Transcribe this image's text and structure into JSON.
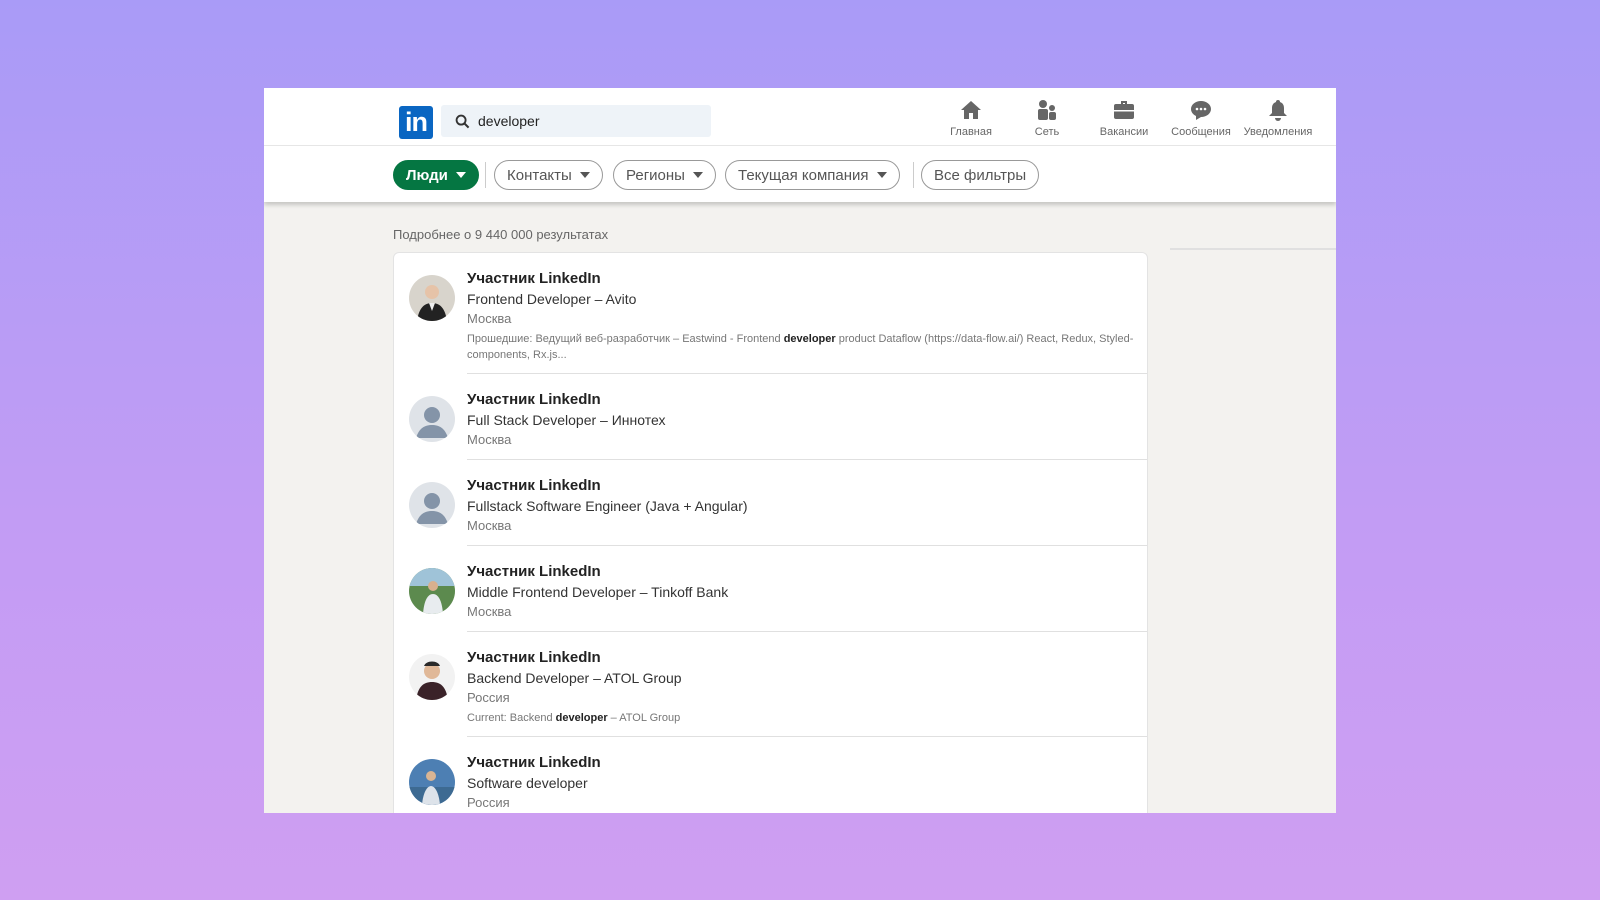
{
  "header": {
    "search_value": "developer",
    "nav": [
      {
        "icon": "home-icon",
        "label": "Главная"
      },
      {
        "icon": "network-icon",
        "label": "Сеть"
      },
      {
        "icon": "briefcase-icon",
        "label": "Вакансии"
      },
      {
        "icon": "messages-icon",
        "label": "Сообщения"
      },
      {
        "icon": "bell-icon",
        "label": "Уведомления"
      }
    ]
  },
  "filters": {
    "people": "Люди",
    "contacts": "Контакты",
    "regions": "Регионы",
    "company": "Текущая компания",
    "all": "Все фильтры"
  },
  "results": {
    "count": "Подробнее о 9 440 000 результатах",
    "items": [
      {
        "name": "Участник LinkedIn",
        "title": "Frontend Developer – Avito",
        "location": "Москва",
        "snippet_pre": "Прошедшие: Ведущий веб-разработчик – Eastwind - Frontend ",
        "snippet_bold": "developer",
        "snippet_post": " product Dataflow (https://data-flow.ai/) React, Redux, Styled-components, Rx.js..."
      },
      {
        "name": "Участник LinkedIn",
        "title": "Full Stack Developer – Иннотех",
        "location": "Москва"
      },
      {
        "name": "Участник LinkedIn",
        "title": "Fullstack Software Engineer (Java + Angular)",
        "location": "Москва"
      },
      {
        "name": "Участник LinkedIn",
        "title": "Middle Frontend Developer – Tinkoff Bank",
        "location": "Москва"
      },
      {
        "name": "Участник LinkedIn",
        "title": "Backend Developer – ATOL Group",
        "location": "Россия",
        "snippet_pre": "Current: Backend ",
        "snippet_bold": "developer",
        "snippet_post": " – ATOL Group"
      },
      {
        "name": "Участник LinkedIn",
        "title": "Software developer",
        "location": "Россия"
      }
    ]
  },
  "colors": {
    "brand": "#0a66c2",
    "active_filter": "#057642"
  }
}
